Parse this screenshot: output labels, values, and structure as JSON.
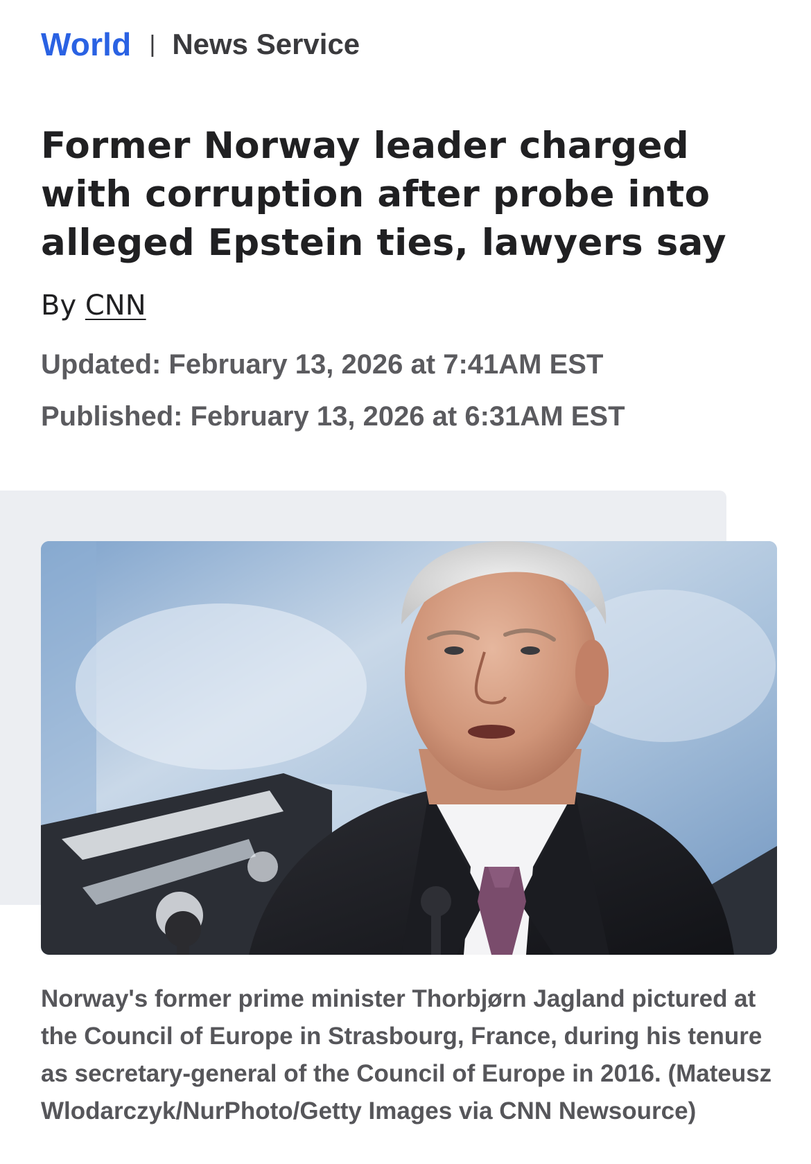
{
  "nav": {
    "section": "World",
    "separator": "|",
    "service": "News Service"
  },
  "article": {
    "headline": "Former Norway leader charged with corruption after probe into alleged Epstein ties, lawyers say",
    "byline_prefix": "By",
    "author": "CNN",
    "updated": "Updated: February 13, 2026 at 7:41AM EST",
    "published": "Published: February 13, 2026 at 6:31AM EST"
  },
  "photo": {
    "caption": "Norway's former prime minister Thorbjørn Jagland pictured at the Council of Europe in Strasbourg, France, during his tenure as secretary-general of the Council of Europe in 2016. (Mateusz Wlodarczyk/NurPhoto/Getty Images via CNN Newsource)"
  },
  "colors": {
    "accent": "#2a62e3",
    "text": "#202022",
    "meta": "#5b5b5f",
    "panel": "#eceef2"
  }
}
